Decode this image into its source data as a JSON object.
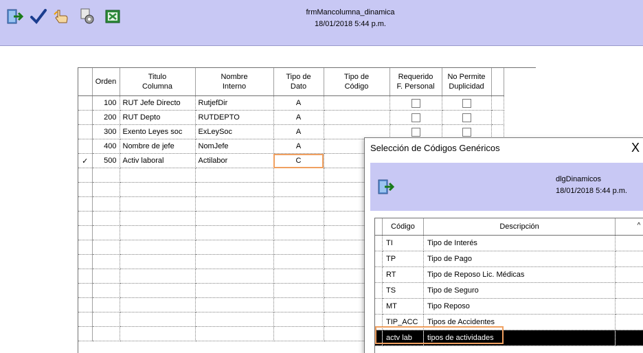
{
  "header": {
    "form_name": "frmMancolumna_dinamica",
    "datetime": "18/01/2018 5:44 p.m.",
    "toolbar": [
      {
        "name": "exit-icon"
      },
      {
        "name": "checkmark-icon"
      },
      {
        "name": "hand-pointer-icon"
      },
      {
        "name": "gears-icon"
      },
      {
        "name": "excel-icon"
      }
    ]
  },
  "grid": {
    "columns": [
      {
        "label1": "",
        "label2": ""
      },
      {
        "label1": "",
        "label2": "Orden"
      },
      {
        "label1": "Titulo",
        "label2": "Columna"
      },
      {
        "label1": "Nombre",
        "label2": "Interno"
      },
      {
        "label1": "Tipo de",
        "label2": "Dato"
      },
      {
        "label1": "Tipo de",
        "label2": "Código"
      },
      {
        "label1": "Requerido",
        "label2": "F. Personal"
      },
      {
        "label1": "No Permite",
        "label2": "Duplicidad"
      },
      {
        "label1": "",
        "label2": ""
      }
    ],
    "rows": [
      {
        "marker": "",
        "orden": "100",
        "titulo": "RUT Jefe Directo",
        "nombre": "RutjefDir",
        "tipo_dato": "A",
        "tipo_codigo": "",
        "requerido": false,
        "no_permite": false
      },
      {
        "marker": "",
        "orden": "200",
        "titulo": "RUT Depto",
        "nombre": "RUTDEPTO",
        "tipo_dato": "A",
        "tipo_codigo": "",
        "requerido": false,
        "no_permite": false
      },
      {
        "marker": "",
        "orden": "300",
        "titulo": "Exento Leyes soc",
        "nombre": "ExLeySoc",
        "tipo_dato": "A",
        "tipo_codigo": "",
        "requerido": false,
        "no_permite": false
      },
      {
        "marker": "",
        "orden": "400",
        "titulo": "Nombre de jefe",
        "nombre": "NomJefe",
        "tipo_dato": "A",
        "tipo_codigo": "",
        "requerido": false,
        "no_permite": false
      },
      {
        "marker": "✓",
        "orden": "500",
        "titulo": "Activ laboral",
        "nombre": "Actilabor",
        "tipo_dato": "C",
        "tipo_codigo": "",
        "requerido": false,
        "no_permite": false
      }
    ],
    "empty_rows": 12
  },
  "dialog": {
    "title": "Selección de Códigos Genéricos",
    "close_label": "X",
    "form_name": "dlgDinamicos",
    "datetime": "18/01/2018 5:44 p.m.",
    "columns": {
      "codigo": "Código",
      "descripcion": "Descripción"
    },
    "rows": [
      {
        "codigo": "TI",
        "descripcion": "Tipo de Interés"
      },
      {
        "codigo": "TP",
        "descripcion": "Tipo de Pago"
      },
      {
        "codigo": "RT",
        "descripcion": "Tipo de Reposo Lic. Médicas"
      },
      {
        "codigo": "TS",
        "descripcion": "Tipo de Seguro"
      },
      {
        "codigo": "MT",
        "descripcion": "Tipo Reposo"
      },
      {
        "codigo": "TIP_ACC",
        "descripcion": "Tipos de Accidentes"
      },
      {
        "codigo": "actv lab",
        "descripcion": "tipos de actividades"
      }
    ],
    "selected_index": 6,
    "scroll_up": "^"
  }
}
